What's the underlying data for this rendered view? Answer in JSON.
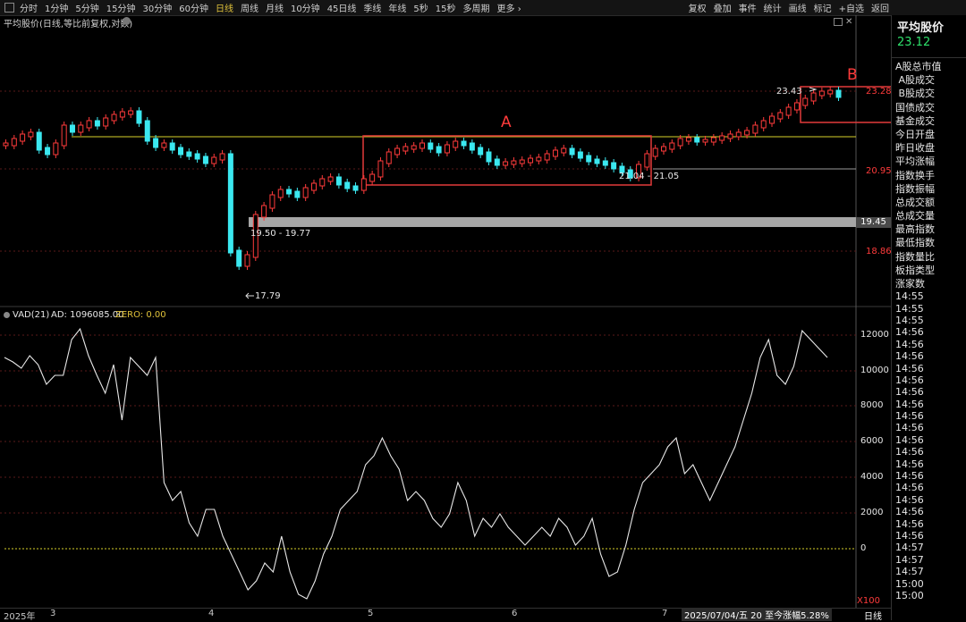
{
  "toolbar": {
    "periods": [
      "分时",
      "1分钟",
      "5分钟",
      "15分钟",
      "30分钟",
      "60分钟",
      "日线",
      "周线",
      "月线",
      "10分钟",
      "45日线",
      "季线",
      "年线",
      "5秒",
      "15秒",
      "多周期",
      "更多 ›"
    ],
    "active_period": "日线",
    "tools": [
      "复权",
      "叠加",
      "事件",
      "统计",
      "画线",
      "标记",
      "+自选",
      "返回"
    ]
  },
  "chart_header": {
    "title": "平均股价(日线,等比前复权,对数)"
  },
  "price_labels": {
    "high_right": "23.28",
    "mid_right": "20.95",
    "gray_band": "19.45",
    "low_right": "18.86",
    "peak_annot": "23.43",
    "range_a": "21.04 - 21.05",
    "range_gap": "19.50 - 19.77",
    "low_annot": "17.79"
  },
  "box_labels": {
    "a": "A",
    "b": "B"
  },
  "indicator": {
    "name": "VAD(21)",
    "ad_label": "AD: 1096085.00",
    "zero_label": "ZERO: 0.00",
    "y_ticks": [
      "12000",
      "10000",
      "8000",
      "6000",
      "4000",
      "2000",
      "0"
    ],
    "x100": "X100"
  },
  "x_axis": {
    "labels": [
      "2025年",
      "3",
      "4",
      "5",
      "6",
      "7"
    ],
    "status": "2025/07/04/五 20 至今涨幅5.28%",
    "mode": "日线"
  },
  "right_panel": {
    "title": "平均股价",
    "price": "23.12",
    "items": [
      "A股总市值",
      "A股成交",
      "B股成交",
      "国债成交",
      "基金成交",
      "今日开盘",
      "昨日收盘",
      "平均涨幅",
      "指数换手",
      "指数振幅",
      "总成交额",
      "总成交量",
      "最高指数",
      "最低指数",
      "指数量比",
      "板指类型",
      "涨家数"
    ],
    "times": [
      "14:55",
      "14:55",
      "14:55",
      "14:56",
      "14:56",
      "14:56",
      "14:56",
      "14:56",
      "14:56",
      "14:56",
      "14:56",
      "14:56",
      "14:56",
      "14:56",
      "14:56",
      "14:56",
      "14:56",
      "14:56",
      "14:56",
      "14:56",
      "14:56",
      "14:57",
      "14:57",
      "14:57",
      "15:00",
      "15:00"
    ]
  },
  "colors": {
    "up": "#ff3b3b",
    "down": "#3be8f0",
    "accent": "#e0c23a",
    "price_green": "#2ee06b"
  }
}
